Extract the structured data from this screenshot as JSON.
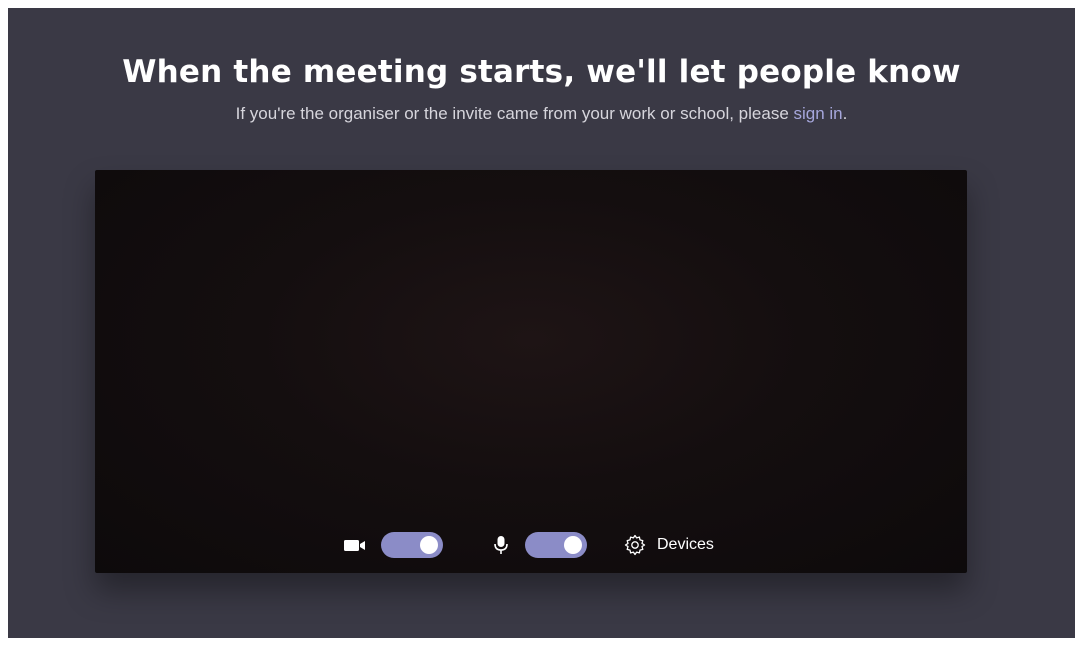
{
  "header": {
    "title": "When the meeting starts, we'll let people know",
    "subtitle_prefix": "If you're the organiser or the invite came from your work or school, please ",
    "signin_label": "sign in",
    "subtitle_suffix": "."
  },
  "controls": {
    "camera": {
      "icon": "video-camera-icon",
      "enabled": true
    },
    "microphone": {
      "icon": "microphone-icon",
      "enabled": true
    },
    "devices": {
      "icon": "gear-icon",
      "label": "Devices"
    }
  },
  "colors": {
    "background": "#3a3945",
    "accent": "#8b8cc7",
    "link": "#a6a7dc",
    "preview": "#0d0a0b"
  }
}
